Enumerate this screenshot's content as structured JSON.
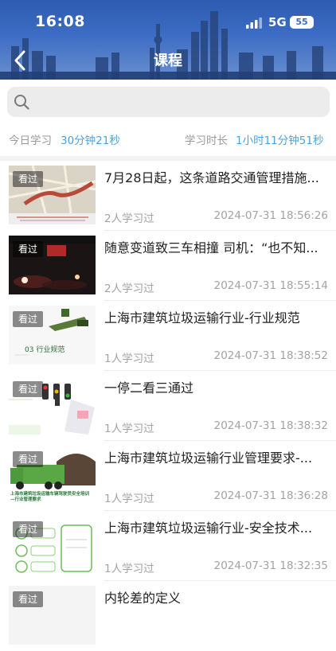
{
  "status_bar": {
    "time": "16:08",
    "network": "5G",
    "battery": "55"
  },
  "header": {
    "title": "课程"
  },
  "search": {
    "placeholder": ""
  },
  "stats": {
    "today_label": "今日学习",
    "today_value": "30分钟21秒",
    "total_label": "学习时长",
    "total_value": "1小时11分钟51秒"
  },
  "courses": [
    {
      "badge": "看过",
      "title": "7月28日起，这条道路交通管理措施...",
      "count": "2人学习过",
      "date": "2024-07-31 18:56:26"
    },
    {
      "badge": "看过",
      "title": "随意变道致三车相撞 司机：“也不知...",
      "count": "2人学习过",
      "date": "2024-07-31 18:55:14"
    },
    {
      "badge": "看过",
      "title": "上海市建筑垃圾运输行业-行业规范",
      "count": "1人学习过",
      "date": "2024-07-31 18:38:52"
    },
    {
      "badge": "看过",
      "title": "一停二看三通过",
      "count": "1人学习过",
      "date": "2024-07-31 18:38:32"
    },
    {
      "badge": "看过",
      "title": "上海市建筑垃圾运输行业管理要求-...",
      "count": "1人学习过",
      "date": "2024-07-31 18:36:28"
    },
    {
      "badge": "看过",
      "title": "上海市建筑垃圾运输行业-安全技术...",
      "count": "1人学习过",
      "date": "2024-07-31 18:32:35"
    },
    {
      "badge": "看过",
      "title": "内轮差的定义",
      "count": "",
      "date": ""
    }
  ],
  "thumb_texts": {
    "t3": "03 行业规范",
    "t5": "上海市建筑垃圾运输车辆驾驶员安全培训 —行业管理要求"
  }
}
